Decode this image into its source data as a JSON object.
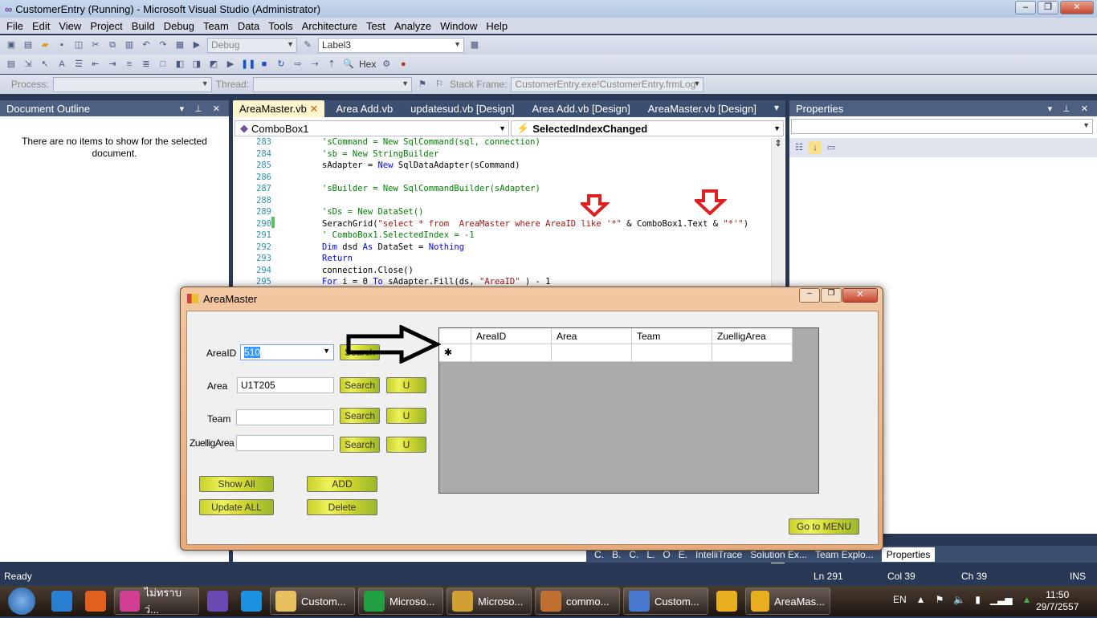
{
  "window": {
    "title": "CustomerEntry (Running) - Microsoft Visual Studio (Administrator)",
    "min": "–",
    "max": "❐",
    "close": "✕"
  },
  "menu": [
    "File",
    "Edit",
    "View",
    "Project",
    "Build",
    "Debug",
    "Team",
    "Data",
    "Tools",
    "Architecture",
    "Test",
    "Analyze",
    "Window",
    "Help"
  ],
  "toolbar": {
    "config": "Debug",
    "target": "Label3",
    "hex": "Hex",
    "process_label": "Process:",
    "thread_label": "Thread:",
    "stackframe_label": "Stack Frame:",
    "stackframe_value": "CustomerEntry.exe!CustomerEntry.frmLog"
  },
  "doc_outline": {
    "title": "Document Outline",
    "message": "There are no items to show for the selected document."
  },
  "editor": {
    "tabs": [
      "AreaMaster.vb",
      "Area Add.vb",
      "updatesud.vb [Design]",
      "Area Add.vb [Design]",
      "AreaMaster.vb [Design]"
    ],
    "object_combo": "ComboBox1",
    "event_combo": "SelectedIndexChanged",
    "lines": [
      {
        "n": "283",
        "parts": [
          [
            "cm",
            "'sCommand = New SqlCommand(sql, connection)"
          ]
        ]
      },
      {
        "n": "284",
        "parts": [
          [
            "cm",
            "'sb = New StringBuilder"
          ]
        ]
      },
      {
        "n": "285",
        "parts": [
          [
            "",
            "sAdapter = "
          ],
          [
            "kw",
            "New"
          ],
          [
            "",
            " SqlDataAdapter(sCommand)"
          ]
        ]
      },
      {
        "n": "286",
        "parts": []
      },
      {
        "n": "287",
        "parts": [
          [
            "cm",
            "'sBuilder = New SqlCommandBuilder(sAdapter)"
          ]
        ]
      },
      {
        "n": "288",
        "parts": []
      },
      {
        "n": "289",
        "parts": [
          [
            "cm",
            "'sDs = New DataSet()"
          ]
        ]
      },
      {
        "n": "290",
        "parts": [
          [
            "",
            "SerachGrid("
          ],
          [
            "st",
            "\"select * from  AreaMaster where AreaID like '*\""
          ],
          [
            "",
            " & ComboBox1.Text & "
          ],
          [
            "st",
            "\"*'\""
          ],
          [
            "",
            ")"
          ]
        ]
      },
      {
        "n": "291",
        "parts": [
          [
            "cm",
            "' ComboBox1.SelectedIndex = -1"
          ]
        ]
      },
      {
        "n": "292",
        "parts": [
          [
            "kw",
            "Dim"
          ],
          [
            "",
            " dsd "
          ],
          [
            "kw",
            "As"
          ],
          [
            "",
            " DataSet = "
          ],
          [
            "kw",
            "Nothing"
          ]
        ]
      },
      {
        "n": "293",
        "parts": [
          [
            "kw",
            "Return"
          ]
        ]
      },
      {
        "n": "294",
        "parts": [
          [
            "",
            "connection.Close()"
          ]
        ]
      },
      {
        "n": "295",
        "parts": [
          [
            "kw",
            "For"
          ],
          [
            "",
            " i = 0 "
          ],
          [
            "kw",
            "To"
          ],
          [
            "",
            " sAdapter.Fill(ds, "
          ],
          [
            "st",
            "\"AreaID\""
          ],
          [
            "",
            " ) - 1"
          ]
        ]
      }
    ]
  },
  "properties": {
    "title": "Properties"
  },
  "bottom_tabs": [
    "C.",
    "B.",
    "C.",
    "L.",
    "O",
    "E.",
    "IntelliTrace",
    "Solution Ex...",
    "Team Explo...",
    "Properties"
  ],
  "status": {
    "ready": "Ready",
    "ln": "Ln 291",
    "col": "Col 39",
    "ch": "Ch 39",
    "ins": "INS"
  },
  "dialog": {
    "title": "AreaMaster",
    "areaid_label": "AreaID",
    "areaid_value": "510",
    "area_label": "Area",
    "area_value": "U1T205",
    "team_label": "Team",
    "team_value": "",
    "zuellig_label": "ZuelligArea",
    "zuellig_value": "",
    "search": "Search",
    "u": "U",
    "show_all": "Show All",
    "update_all": "Update ALL",
    "add": "ADD",
    "delete": "Delete",
    "go_menu": "Go to MENU",
    "grid_columns": [
      "AreaID",
      "Area",
      "Team",
      "ZuelligArea"
    ],
    "new_row_marker": "✱"
  },
  "taskbar": {
    "items": [
      "",
      "",
      "ไม่ทราบว่...",
      "",
      "",
      "Custom...",
      "Microso...",
      "Microso...",
      "commo...",
      "Custom...",
      "",
      "AreaMas..."
    ],
    "lang": "EN",
    "time": "11:50",
    "date": "29/7/2557"
  },
  "colors": {
    "accent": "#293955",
    "button_yellow": "#e0e640",
    "arrow_red": "#e02020"
  }
}
